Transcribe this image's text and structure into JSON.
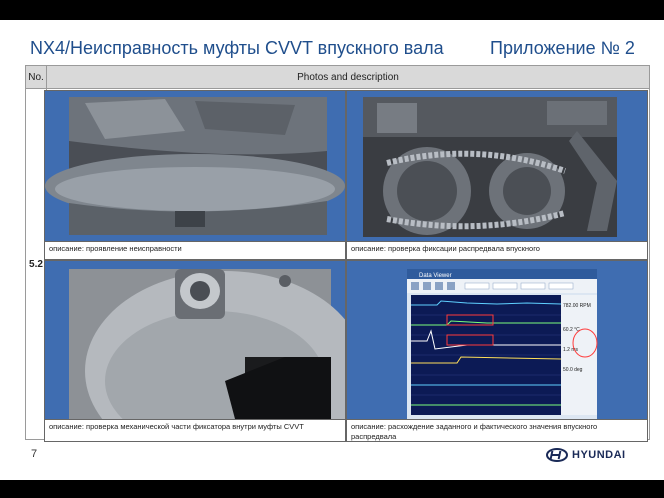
{
  "slide": {
    "title": "NX4/Неисправность муфты CVVT впускного вала",
    "appendix": "Приложение № 2",
    "page_number": "7",
    "logo_text": "HYUNDAI"
  },
  "table": {
    "header_no": "No.",
    "header_photos": "Photos and description",
    "row_no": "5.2",
    "cells": [
      {
        "caption": "описание: проявление неисправности"
      },
      {
        "caption": "описание: проверка фиксации распредвала впускного"
      },
      {
        "caption": "описание: проверка механической части фиксатора внутри муфты CVVT"
      },
      {
        "caption": "описание: расхождение заданного и фактического значения впускного распредвала"
      }
    ]
  },
  "data_viewer": {
    "window_title": "Data Viewer",
    "readouts": [
      "782.00 RPM",
      "60.2 °C",
      "1.2 ms",
      "50.0 deg"
    ]
  }
}
